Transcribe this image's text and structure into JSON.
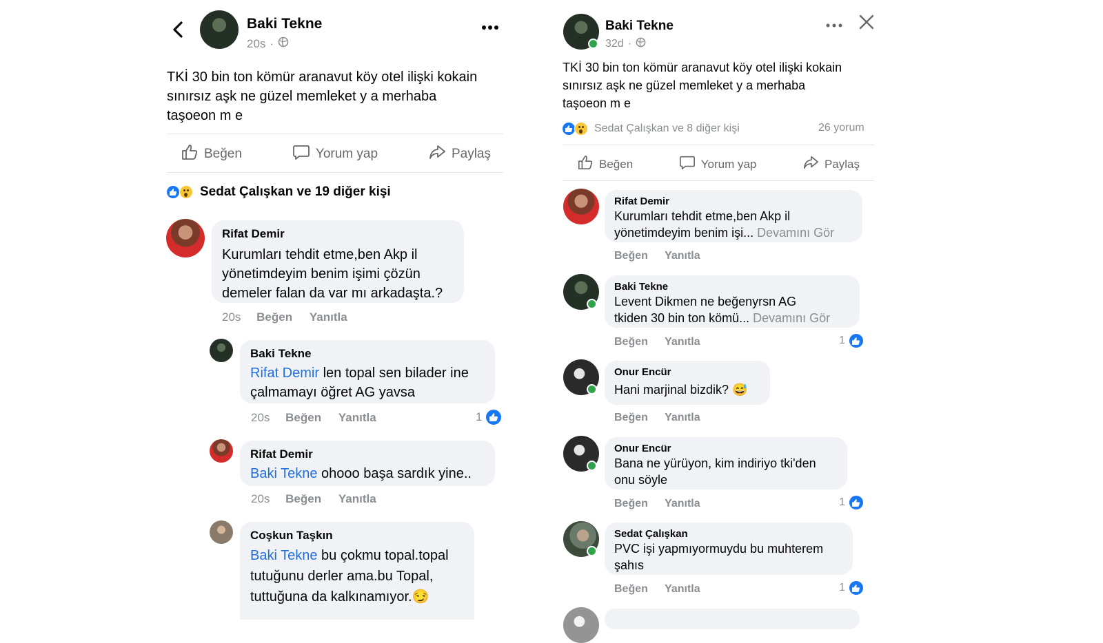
{
  "left": {
    "author": "Baki Tekne",
    "time": "20s",
    "post_text_l1": "TKİ 30 bin ton kömür aranavut köy otel ilişki kokain",
    "post_text_l2": "sınırsız aşk ne güzel memleket y a merhaba",
    "post_text_l3": "taşoeon m e",
    "actions": {
      "like": "Beğen",
      "comment": "Yorum yap",
      "share": "Paylaş"
    },
    "reactions_text": "Sedat Çalışkan ve 19 diğer kişi",
    "comments": [
      {
        "name": "Rifat Demir",
        "l1": "Kurumları tehdit etme,ben Akp il",
        "l2": "yönetimdeyim benim işimi çözün",
        "l3": "demeler falan da var mı arkadaşta.?",
        "time": "20s",
        "like": "Beğen",
        "reply": "Yanıtla"
      },
      {
        "name": "Baki Tekne",
        "mention": "Rifat Demir",
        "l1": " len topal sen bilader ine",
        "l2": "çalmamayı öğret AG yavsa",
        "time": "20s",
        "like": "Beğen",
        "reply": "Yanıtla",
        "likes": "1"
      },
      {
        "name": "Rifat Demir",
        "mention": "Baki Tekne",
        "l1": " ohooo başa sardık yine..",
        "time": "20s",
        "like": "Beğen",
        "reply": "Yanıtla"
      },
      {
        "name": "Coşkun Taşkın",
        "mention": "Baki Tekne",
        "l1": " bu çokmu topal.topal",
        "l2": "tutuğunu derler ama.bu Topal,",
        "l3": "tuttuğuna da kalkınamıyor.😏"
      }
    ]
  },
  "right": {
    "author": "Baki Tekne",
    "time": "32d",
    "post_text_l1": "TKİ 30 bin ton kömür aranavut köy otel ilişki kokain",
    "post_text_l2": "sınırsız aşk ne güzel memleket y a merhaba",
    "post_text_l3": "taşoeon m e",
    "reactions_text": "Sedat Çalışkan ve 8 diğer kişi",
    "comment_count": "26 yorum",
    "actions": {
      "like": "Beğen",
      "comment": "Yorum yap",
      "share": "Paylaş"
    },
    "see_more": "Devamını Gör",
    "comments": [
      {
        "name": "Rifat Demir",
        "l1": "Kurumları tehdit etme,ben Akp il",
        "l2": "yönetimdeyim benim işi...",
        "like": "Beğen",
        "reply": "Yanıtla"
      },
      {
        "name": "Baki Tekne",
        "l1": "Levent Dikmen ne beğenyrsn AG",
        "l2": "tkiden 30 bin ton kömü...",
        "like": "Beğen",
        "reply": "Yanıtla",
        "likes": "1"
      },
      {
        "name": "Onur Encür",
        "l1": "Hani marjinal bizdik? 😅",
        "like": "Beğen",
        "reply": "Yanıtla"
      },
      {
        "name": "Onur Encür",
        "l1": "Bana ne yürüyon, kim indiriyo tki'den",
        "l2": "onu söyle",
        "like": "Beğen",
        "reply": "Yanıtla",
        "likes": "1"
      },
      {
        "name": "Sedat Çalışkan",
        "l1": "PVC işi yapmıyormuydu bu muhterem",
        "l2": "şahıs",
        "like": "Beğen",
        "reply": "Yanıtla",
        "likes": "1"
      }
    ]
  },
  "colors": {
    "link": "#216fdb",
    "like_blue": "#1877f2",
    "bubble": "#f0f2f5",
    "muted": "#8a8d91",
    "online": "#31a24c"
  },
  "icons": [
    "back-arrow-icon",
    "more-icon",
    "globe-icon",
    "thumbs-up-icon",
    "comment-icon",
    "share-icon",
    "close-icon",
    "like-reaction-icon",
    "wow-reaction-icon"
  ]
}
